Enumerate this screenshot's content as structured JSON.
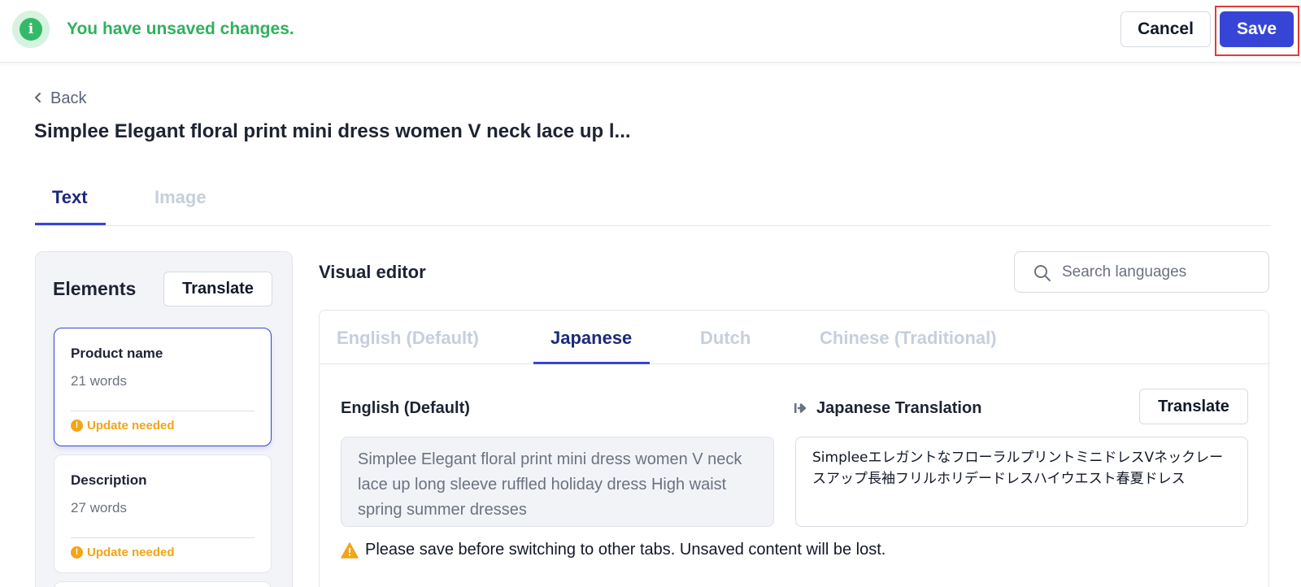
{
  "topbar": {
    "message": "You have unsaved changes.",
    "info_icon_glyph": "i",
    "cancel_label": "Cancel",
    "save_label": "Save"
  },
  "header": {
    "back_label": "Back",
    "title": "Simplee Elegant floral print mini dress women V neck lace up l..."
  },
  "main_tabs": [
    {
      "label": "Text",
      "active": true
    },
    {
      "label": "Image",
      "active": false
    }
  ],
  "elements": {
    "title": "Elements",
    "translate_label": "Translate",
    "items": [
      {
        "name": "Product name",
        "words": "21 words",
        "status": "Update needed",
        "selected": true
      },
      {
        "name": "Description",
        "words": "27 words",
        "status": "Update needed",
        "selected": false
      }
    ]
  },
  "visual_editor": {
    "title": "Visual editor",
    "search_placeholder": "Search languages",
    "language_tabs": [
      {
        "label": "English (Default)",
        "active": false
      },
      {
        "label": "Japanese",
        "active": true
      },
      {
        "label": "Dutch",
        "active": false
      },
      {
        "label": "Chinese (Traditional)",
        "active": false
      }
    ],
    "source_label": "English (Default)",
    "source_text": "Simplee Elegant floral print mini dress women V neck lace up long sleeve ruffled holiday dress High waist spring summer dresses",
    "target_label": "Japanese Translation",
    "translate_label": "Translate",
    "target_text": "SimpleeエレガントなフローラルプリントミニドレスVネックレースアップ長袖フリルホリデードレスハイウエスト春夏ドレス",
    "warning": "Please save before switching to other tabs. Unsaved content will be lost."
  },
  "colors": {
    "accent": "#3745d6",
    "success": "#2fb15e",
    "warning": "#f2a516",
    "highlight_outline": "#e53935"
  }
}
